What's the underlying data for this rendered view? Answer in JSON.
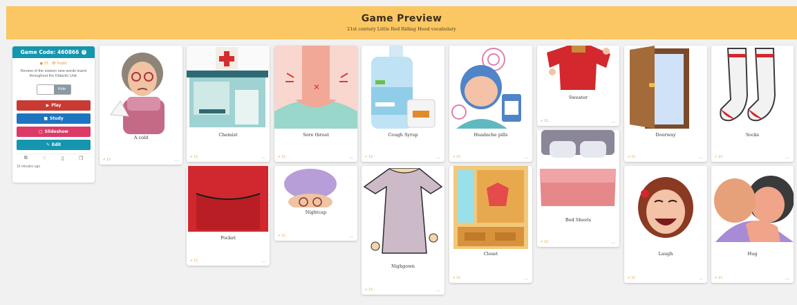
{
  "header": {
    "title": "Game Preview",
    "subtitle": "21st century Little Red Riding Hood vocabulary"
  },
  "panel": {
    "game_code": "Game Code: 460866",
    "meta": "● 15 · 👁 Public",
    "description": "Review of the sixteen new words learnt throughout the Didactic Unit.",
    "toggle_label": "Hide",
    "buttons": {
      "play": "Play",
      "study": "Study",
      "slideshow": "Slideshow",
      "edit": "Edit"
    },
    "time_ago": "16 minutes ago"
  },
  "colors": {
    "header_bg": "#fac763",
    "teal": "#1496ae",
    "play": "#c83a32",
    "study": "#2075c0",
    "slideshow": "#dc3a67",
    "count_orange": "#e69a28"
  },
  "cards": {
    "a_cold": {
      "label": "A cold",
      "count": "✔ 15"
    },
    "chemist": {
      "label": "Chemist",
      "count": "✔ 15"
    },
    "sore_throat": {
      "label": "Sore throat",
      "count": "✔ 15"
    },
    "cough_syrup": {
      "label": "Cough Syrup",
      "count": "✔ 15"
    },
    "headache_pills": {
      "label": "Headache pills",
      "count": "✔ 15"
    },
    "sweater": {
      "label": "Sweater",
      "count": "✔ 15"
    },
    "doorway": {
      "label": "Doorway",
      "count": "✔ 15"
    },
    "socks": {
      "label": "Socks",
      "count": "✔ 15"
    },
    "pocket": {
      "label": "Pocket",
      "count": "✔ 15"
    },
    "nightcap": {
      "label": "Nightcap",
      "count": "✔ 15"
    },
    "nighgown": {
      "label": "Nighgown",
      "count": "✔ 15"
    },
    "closet": {
      "label": "Closet",
      "count": "✔ 15"
    },
    "bed_sheets": {
      "label": "Bed Sheets",
      "count": "✔ 15"
    },
    "laugh": {
      "label": "Laugh",
      "count": "✔ 15"
    },
    "hug": {
      "label": "Hug",
      "count": "✔ 15"
    }
  }
}
